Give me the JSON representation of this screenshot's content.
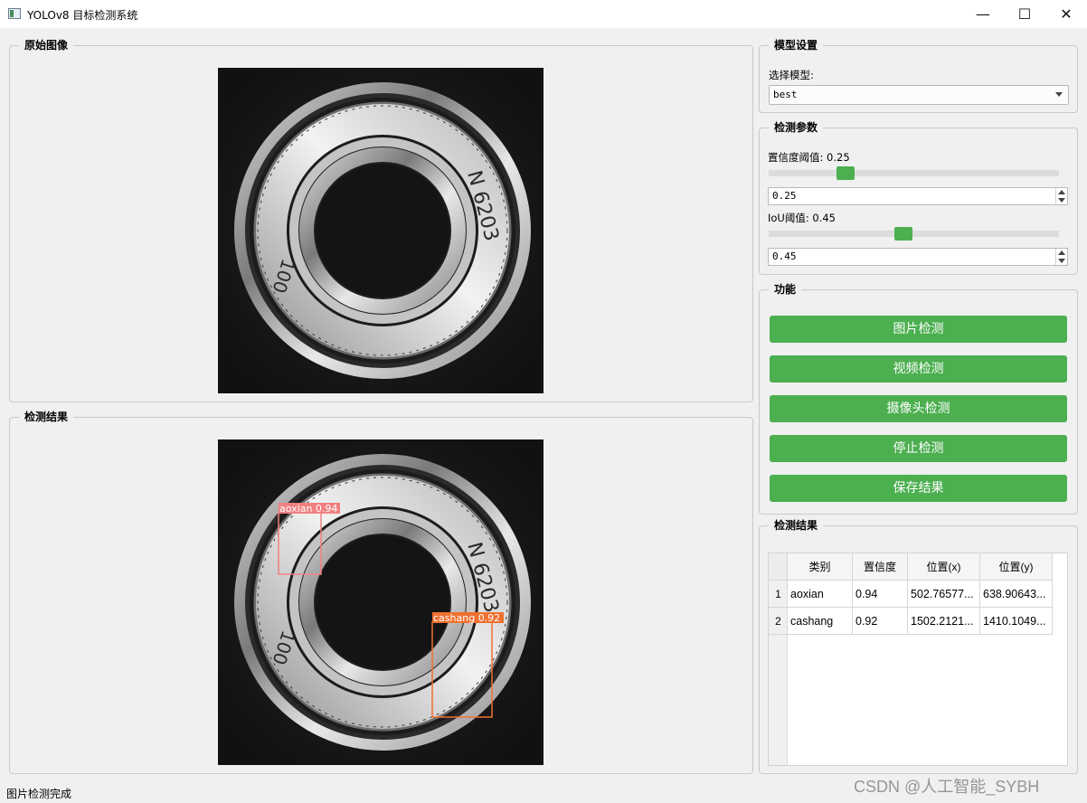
{
  "window": {
    "title": "YOLOv8 目标检测系统",
    "controls": {
      "minimize": "—",
      "maximize": "☐",
      "close": "✕"
    }
  },
  "original_panel": {
    "title": "原始图像"
  },
  "result_panel": {
    "title": "检测结果",
    "detections": [
      {
        "label": "aoxian",
        "confidence": "0.94",
        "color": "#f08080"
      },
      {
        "label": "cashang",
        "confidence": "0.92",
        "color": "#f07030"
      }
    ]
  },
  "model_settings": {
    "title": "模型设置",
    "select_label": "选择模型:",
    "selected_model": "best"
  },
  "detection_params": {
    "title": "检测参数",
    "confidence_label": "置信度阈值: 0.25",
    "confidence_value": "0.25",
    "confidence_level": 0.25,
    "iou_label": "IoU阈值: 0.45",
    "iou_value": "0.45",
    "iou_level": 0.45
  },
  "functions": {
    "title": "功能",
    "buttons": {
      "image": "图片检测",
      "video": "视频检测",
      "camera": "摄像头检测",
      "stop": "停止检测",
      "save": "保存结果"
    },
    "button_color": "#4caf50"
  },
  "results_table": {
    "title": "检测结果",
    "headers": [
      "类别",
      "置信度",
      "位置(x)",
      "位置(y)"
    ],
    "rows": [
      {
        "index": "1",
        "cells": [
          "aoxian",
          "0.94",
          "502.76577...",
          "638.90643..."
        ]
      },
      {
        "index": "2",
        "cells": [
          "cashang",
          "0.92",
          "1502.2121...",
          "1410.1049..."
        ]
      }
    ]
  },
  "status": "图片检测完成",
  "watermark": "CSDN @人工智能_SYBH"
}
